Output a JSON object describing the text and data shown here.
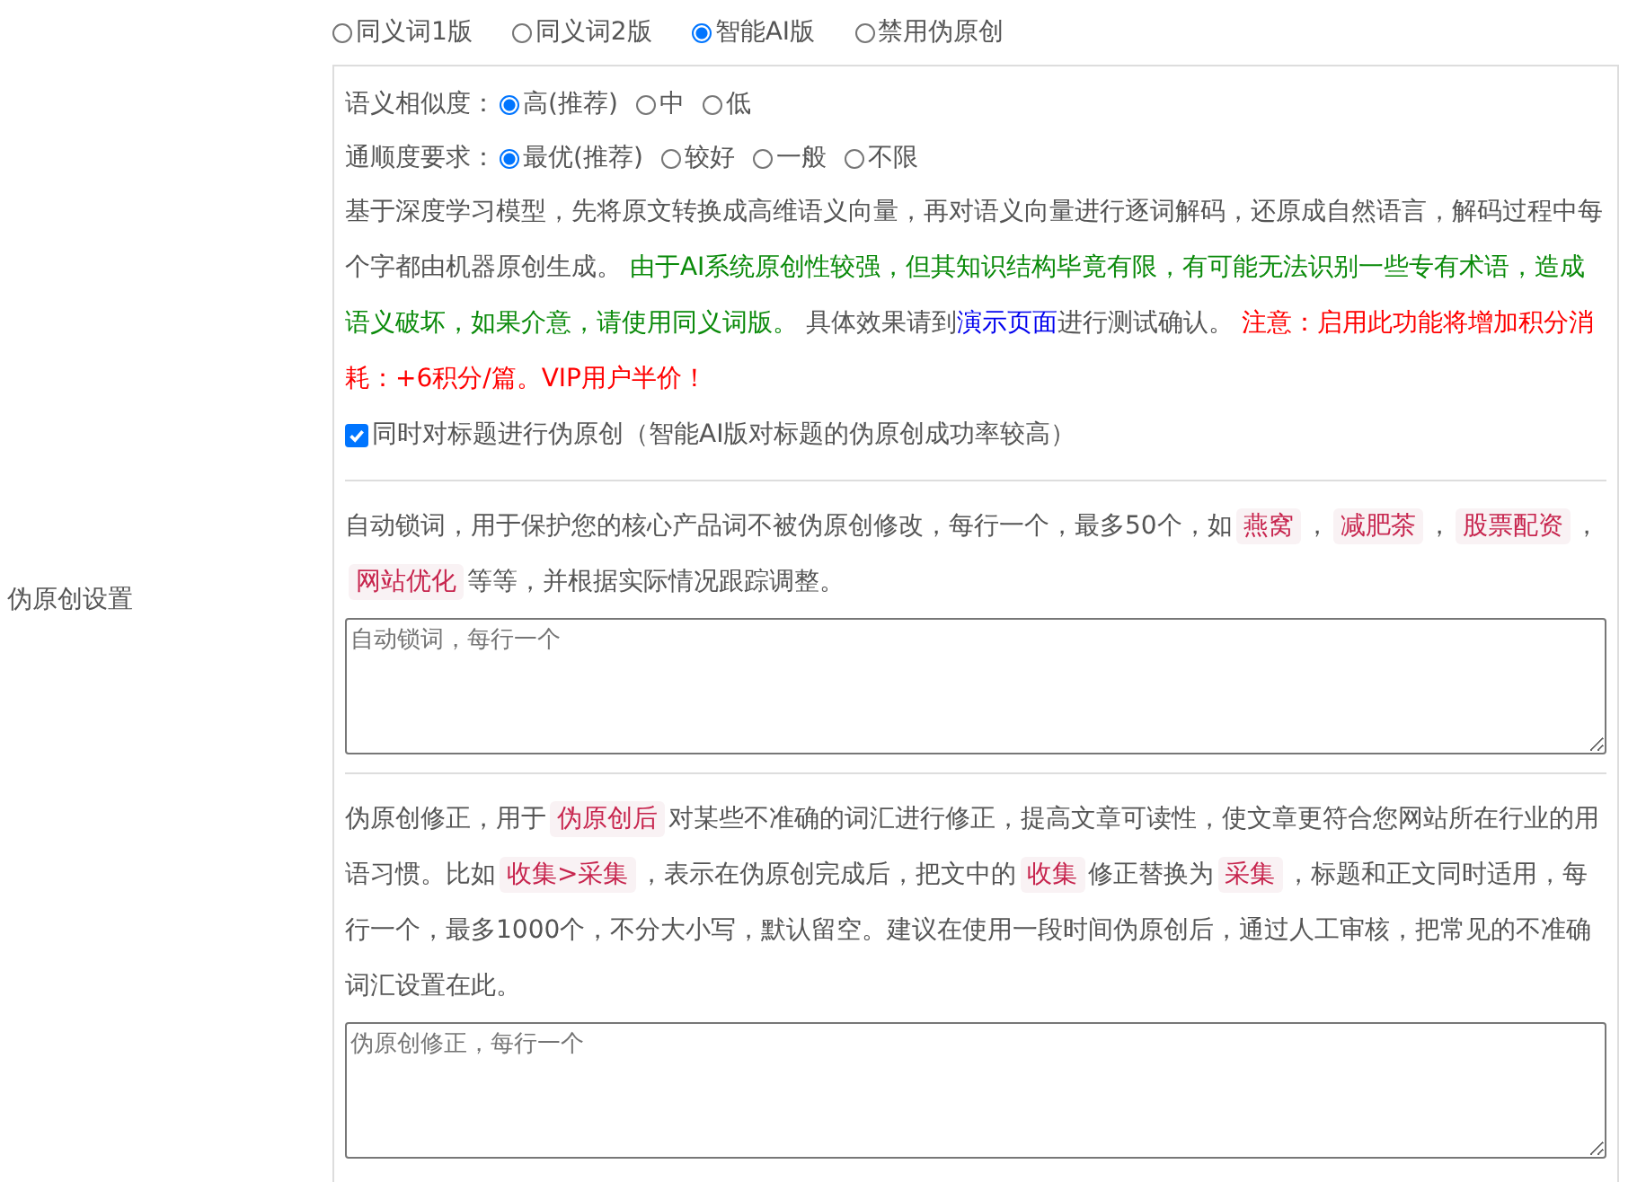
{
  "setting_label": "伪原创设置",
  "modes": [
    {
      "label": "同义词1版",
      "selected": false
    },
    {
      "label": "同义词2版",
      "selected": false
    },
    {
      "label": "智能AI版",
      "selected": true
    },
    {
      "label": "禁用伪原创",
      "selected": false
    }
  ],
  "option_groups": [
    {
      "label": "语义相似度：",
      "options": [
        {
          "label": "高(推荐)",
          "selected": true
        },
        {
          "label": "中",
          "selected": false
        },
        {
          "label": "低",
          "selected": false
        }
      ]
    },
    {
      "label": "通顺度要求：",
      "options": [
        {
          "label": "最优(推荐)",
          "selected": true
        },
        {
          "label": "较好",
          "selected": false
        },
        {
          "label": "一般",
          "selected": false
        },
        {
          "label": "不限",
          "selected": false
        }
      ]
    }
  ],
  "ai_description": [
    {
      "kind": "plain",
      "text": "基于深度学习模型，先将原文转换成高维语义向量，再对语义向量进行逐词解码，还原成自然语言，解码过程中每个字都由机器原创生成。 "
    },
    {
      "kind": "green",
      "text": "由于AI系统原创性较强，但其知识结构毕竟有限，有可能无法识别一些专有术语，造成语义破坏，如果介意，请使用同义词版。"
    },
    {
      "kind": "plain",
      "text": " 具体效果请到"
    },
    {
      "kind": "link",
      "text": "演示页面"
    },
    {
      "kind": "plain",
      "text": "进行测试确认。 "
    },
    {
      "kind": "red",
      "text": "注意：启用此功能将增加积分消耗：+6积分/篇。VIP用户半价！"
    }
  ],
  "title_option": {
    "label": "同时对标题进行伪原创（智能AI版对标题的伪原创成功率较高）",
    "checked": true
  },
  "sections": [
    {
      "description": [
        {
          "kind": "plain",
          "text": "自动锁词，用于保护您的核心产品词不被伪原创修改，每行一个，最多50个，如"
        },
        {
          "kind": "code",
          "text": "燕窝"
        },
        {
          "kind": "plain",
          "text": "，"
        },
        {
          "kind": "code",
          "text": "减肥茶"
        },
        {
          "kind": "plain",
          "text": "，"
        },
        {
          "kind": "code",
          "text": "股票配资"
        },
        {
          "kind": "plain",
          "text": "，"
        },
        {
          "kind": "code",
          "text": "网站优化"
        },
        {
          "kind": "plain",
          "text": "等等，并根据实际情况跟踪调整。"
        }
      ],
      "placeholder": "自动锁词，每行一个"
    },
    {
      "description": [
        {
          "kind": "plain",
          "text": "伪原创修正，用于"
        },
        {
          "kind": "code",
          "text": "伪原创后"
        },
        {
          "kind": "plain",
          "text": "对某些不准确的词汇进行修正，提高文章可读性，使文章更符合您网站所在行业的用语习惯。比如"
        },
        {
          "kind": "code",
          "text": "收集>采集"
        },
        {
          "kind": "plain",
          "text": "，表示在伪原创完成后，把文中的"
        },
        {
          "kind": "code",
          "text": "收集"
        },
        {
          "kind": "plain",
          "text": "修正替换为"
        },
        {
          "kind": "code",
          "text": "采集"
        },
        {
          "kind": "plain",
          "text": "，标题和正文同时适用，每行一个，最多1000个，不分大小写，默认留空。建议在使用一段时间伪原创后，通过人工审核，把常见的不准确词汇设置在此。"
        }
      ],
      "placeholder": "伪原创修正，每行一个"
    }
  ]
}
